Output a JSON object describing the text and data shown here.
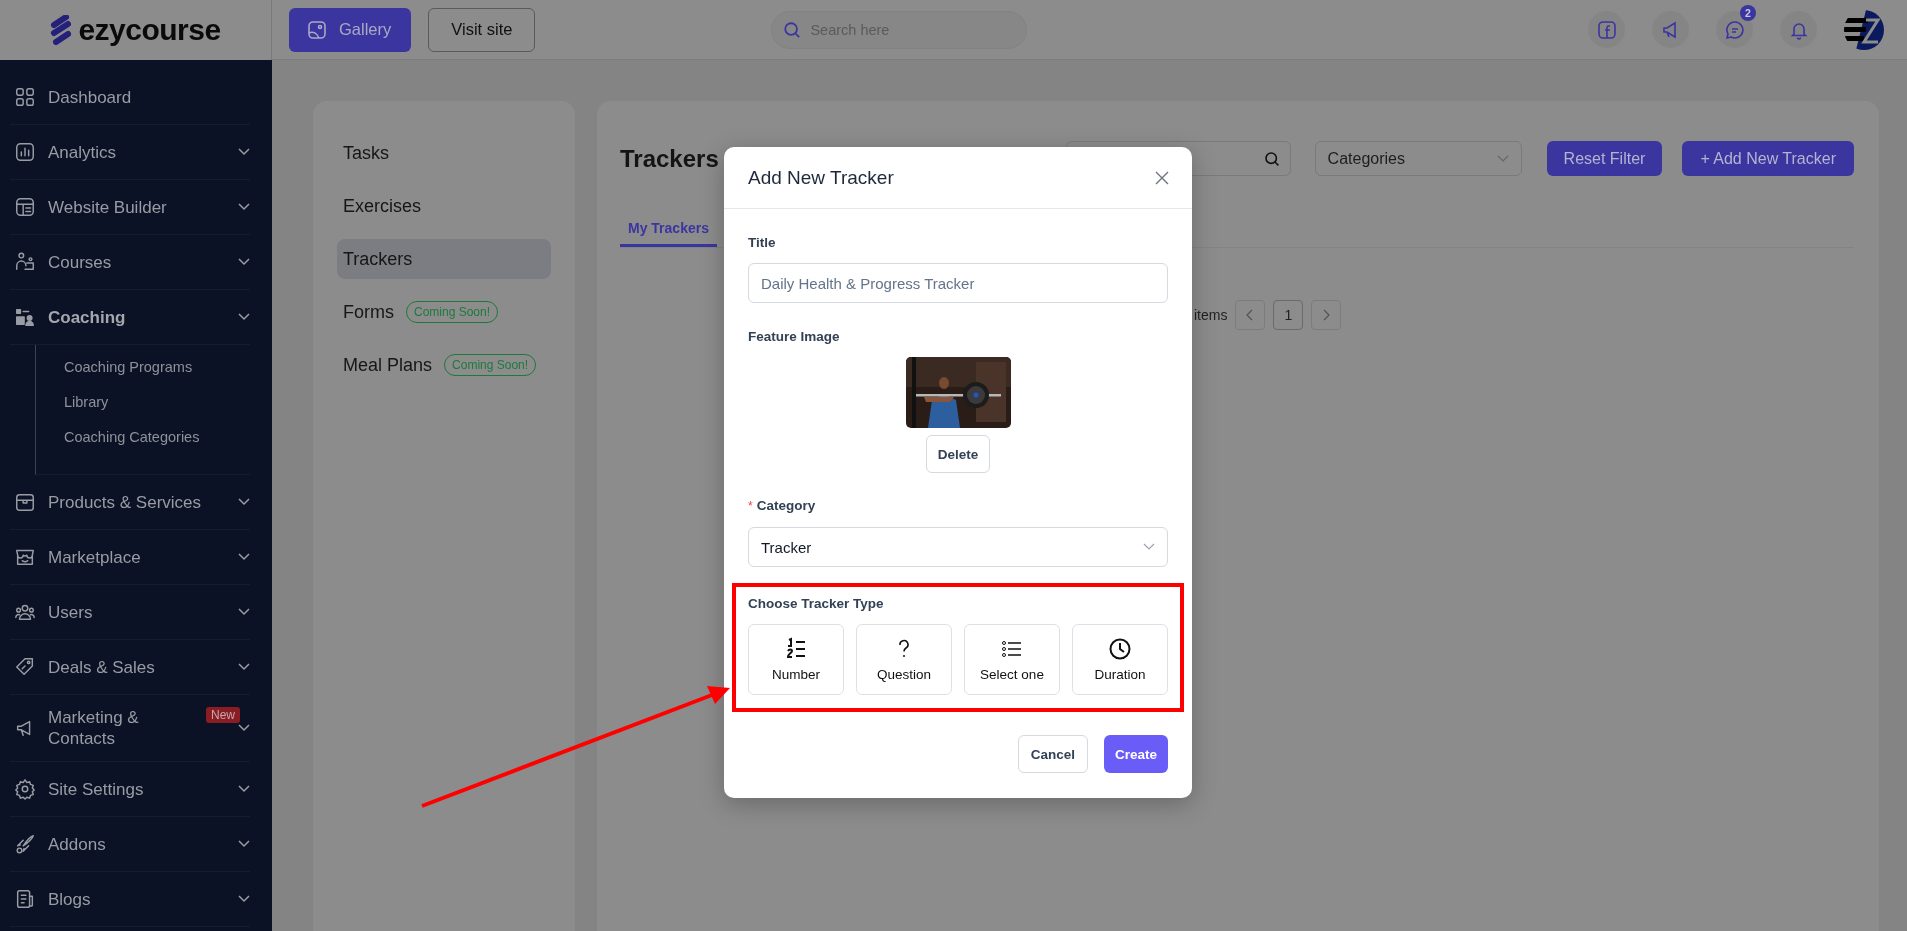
{
  "logo": {
    "text": "ezycourse"
  },
  "sidebar": {
    "items": [
      {
        "label": "Dashboard",
        "expandable": false,
        "selected": false
      },
      {
        "label": "Analytics",
        "expandable": true,
        "selected": false
      },
      {
        "label": "Website Builder",
        "expandable": true,
        "selected": false
      },
      {
        "label": "Courses",
        "expandable": true,
        "selected": false
      },
      {
        "label": "Coaching",
        "expandable": true,
        "selected": true,
        "children": [
          {
            "label": "Coaching Programs"
          },
          {
            "label": "Library"
          },
          {
            "label": "Coaching Categories"
          }
        ]
      },
      {
        "label": "Products & Services",
        "expandable": true,
        "selected": false
      },
      {
        "label": "Marketplace",
        "expandable": true,
        "selected": false
      },
      {
        "label": "Users",
        "expandable": true,
        "selected": false
      },
      {
        "label": "Deals & Sales",
        "expandable": true,
        "selected": false
      },
      {
        "label": "Marketing & Contacts",
        "expandable": true,
        "selected": false,
        "badge": "New"
      },
      {
        "label": "Site Settings",
        "expandable": true,
        "selected": false
      },
      {
        "label": "Addons",
        "expandable": true,
        "selected": false
      },
      {
        "label": "Blogs",
        "expandable": true,
        "selected": false
      }
    ]
  },
  "topbar": {
    "buttons": [
      {
        "label": "Gallery",
        "kind": "primary"
      },
      {
        "label": "Visit site",
        "kind": "outline"
      }
    ],
    "search": {
      "placeholder": "Search here"
    },
    "messages_badge": "2"
  },
  "nav_panel": {
    "items": [
      {
        "label": "Tasks",
        "selected": false
      },
      {
        "label": "Exercises",
        "selected": false
      },
      {
        "label": "Trackers",
        "selected": true
      },
      {
        "label": "Forms",
        "selected": false,
        "badge": "Coming Soon!"
      },
      {
        "label": "Meal Plans",
        "selected": false,
        "badge": "Coming Soon!"
      }
    ]
  },
  "trackers": {
    "title": "Trackers",
    "category_select": "Categories",
    "buttons": [
      {
        "label": "Reset Filter"
      },
      {
        "label": "+ Add New Tracker"
      }
    ],
    "tabs": [
      {
        "label": "My Trackers",
        "selected": true
      }
    ],
    "pagination": {
      "label": "items",
      "pages": [
        {
          "label": "1",
          "selected": true
        }
      ]
    }
  },
  "modal": {
    "title": "Add New Tracker",
    "title_field": {
      "label": "Title",
      "placeholder": "Daily Health & Progress Tracker"
    },
    "feature_image": {
      "label": "Feature Image",
      "kind": "picture",
      "delete_button": "Delete"
    },
    "category": {
      "label": "Category",
      "required_mark": "*",
      "value": "Tracker"
    },
    "tracker_type": {
      "label": "Choose Tracker Type",
      "options": [
        {
          "label": "Number",
          "selected": false
        },
        {
          "label": "Question",
          "selected": false
        },
        {
          "label": "Select one",
          "selected": false
        },
        {
          "label": "Duration",
          "selected": false
        }
      ]
    },
    "buttons": [
      {
        "label": "Cancel",
        "kind": "secondary"
      },
      {
        "label": "Create",
        "kind": "primary"
      }
    ]
  }
}
